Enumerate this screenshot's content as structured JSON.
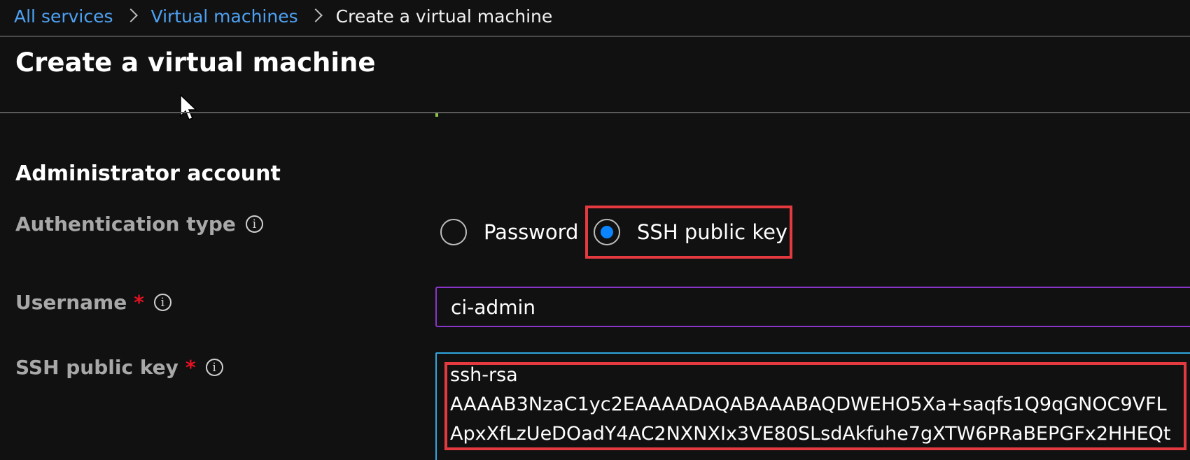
{
  "breadcrumb": {
    "items": [
      "All services",
      "Virtual machines"
    ],
    "current": "Create a virtual machine"
  },
  "page": {
    "title": "Create a virtual machine"
  },
  "section": {
    "title": "Administrator account"
  },
  "fields": {
    "auth_type": {
      "label": "Authentication type",
      "info_icon": "i",
      "options": [
        "Password",
        "SSH public key"
      ],
      "selected": "SSH public key"
    },
    "username": {
      "label": "Username",
      "required_mark": "*",
      "info_icon": "i",
      "value": "ci-admin"
    },
    "ssh_key": {
      "label": "SSH public key",
      "required_mark": "*",
      "info_icon": "i",
      "lines": [
        "ssh-rsa",
        "AAAAB3NzaC1yc2EAAAADAQABAAABAQDWEHO5Xa+saqfs1Q9qGNOC9VFL",
        "ApxXfLzUeDOadY4AC2NXNXIx3VE80SLsdAkfuhe7gXTW6PRaBEPGFx2HHEQt"
      ]
    }
  },
  "colors": {
    "link": "#4ea1f3",
    "radio_selected": "#0a84ff",
    "highlight": "#e43a3f",
    "username_border": "#8a35c9",
    "textarea_border": "#2fa6df",
    "required": "#e81123"
  }
}
